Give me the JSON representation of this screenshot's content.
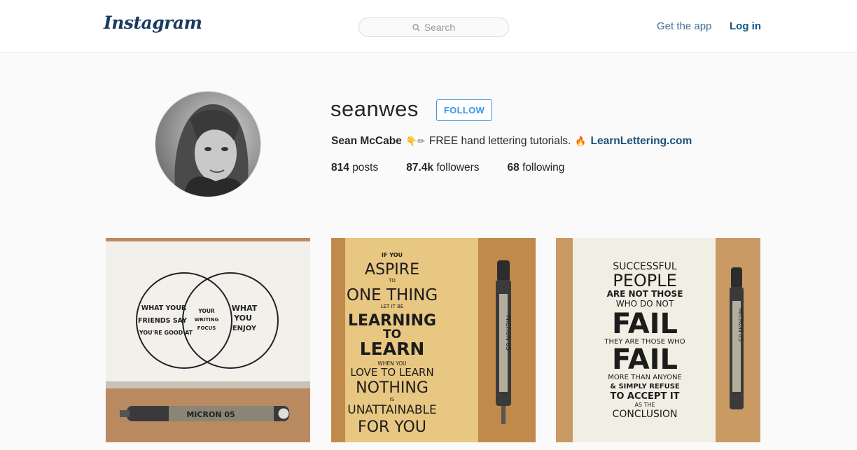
{
  "header": {
    "logo": "Instagram",
    "search_placeholder": "Search",
    "get_app_label": "Get the app",
    "login_label": "Log in"
  },
  "profile": {
    "username": "seanwes",
    "follow_label": "FOLLOW",
    "full_name": "Sean McCabe",
    "bio_emojis": "👇✏",
    "bio_text": "FREE hand lettering tutorials.",
    "bio_emoji2": "🔥",
    "bio_link": "LearnLettering.com",
    "stats": [
      {
        "count": "814",
        "label": "posts"
      },
      {
        "count": "87.4k",
        "label": "followers"
      },
      {
        "count": "68",
        "label": "following"
      }
    ]
  },
  "posts": [
    {
      "venn_left": [
        "WHAT YOUR",
        "FRIENDS SAY",
        "YOU'RE GOOD AT"
      ],
      "venn_center": [
        "YOUR",
        "WRITING",
        "FOCUS"
      ],
      "venn_right": [
        "WHAT",
        "YOU",
        "ENJOY"
      ],
      "pen_label": "MICRON 05"
    },
    {
      "lines": [
        "IF YOU",
        "ASPIRE",
        "TO",
        "ONE THING",
        "LET IT BE",
        "LEARNING",
        "TO",
        "LEARN",
        "WHEN YOU",
        "LOVE TO LEARN",
        "NOTHING",
        "IS",
        "UNATTAINABLE",
        "FOR YOU"
      ],
      "pen_label": "MICRON 05"
    },
    {
      "lines": [
        "SUCCESSFUL",
        "PEOPLE",
        "ARE NOT THOSE",
        "WHO DO NOT",
        "FAIL",
        "THEY ARE THOSE WHO",
        "FAIL",
        "MORE THAN ANYONE",
        "& SIMPLY REFUSE",
        "TO ACCEPT IT",
        "AS THE",
        "CONCLUSION"
      ],
      "pen_label": "MICRON 05"
    }
  ],
  "colors": {
    "brand_blue": "#3897f0",
    "link_blue": "#3f729b",
    "text": "#262626"
  }
}
